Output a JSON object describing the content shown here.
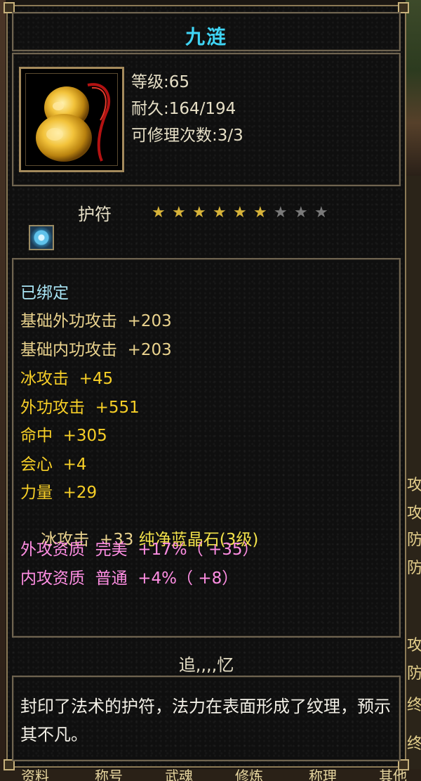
{
  "item": {
    "name": "九涟",
    "stats": [
      "等级:65",
      "耐久:164/194",
      "可修理次数:3/3"
    ],
    "type": "护符",
    "stars": {
      "filled": 6,
      "total": 9
    },
    "bound": "已绑定",
    "attributes": [
      {
        "text": "基础外功攻击  +203",
        "color": "#ead38e"
      },
      {
        "text": "基础内功攻击  +203",
        "color": "#ead38e"
      },
      {
        "text": "冰攻击  +45",
        "color": "#f7cf27"
      },
      {
        "text": "外功攻击  +551",
        "color": "#f7cf27"
      },
      {
        "text": "命中  +305",
        "color": "#f7cf27"
      },
      {
        "text": "会心  +4",
        "color": "#f7cf27"
      },
      {
        "text": "力量  +29",
        "color": "#f7cf27"
      }
    ],
    "gem_line": {
      "prefix": "冰攻击  +33 ",
      "gem": "纯净蓝晶石(3级)"
    },
    "quality_lines": [
      "外攻资质  完美  +17%（ +35）",
      "内攻资质  普通  +4%（ +8）"
    ],
    "section_title": "追,,,,忆",
    "description": "封印了法术的护符，法力在表面形成了纹理，预示其不凡。"
  },
  "background": {
    "side_text": [
      "攻",
      "攻",
      "防",
      "防",
      "攻",
      "防",
      "终",
      "终"
    ],
    "bottom_tabs": [
      "资料",
      "称号",
      "武魂",
      "修炼",
      "称理",
      "其他"
    ]
  },
  "colors": {
    "title": "#3fd4f4",
    "bound": "#a8e4f4",
    "quality": "#ff8ee3",
    "gem": "#f2e24a",
    "star_on": "#d8b43a",
    "star_off": "#7a7a7a"
  }
}
